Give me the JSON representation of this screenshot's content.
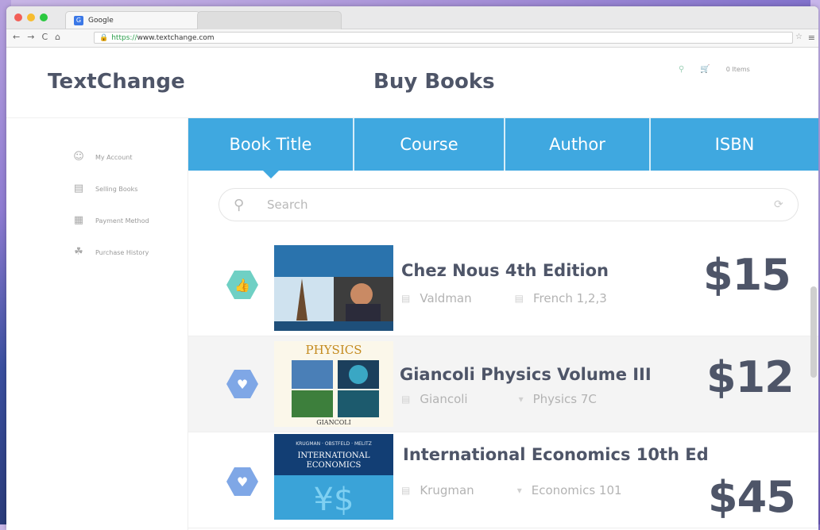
{
  "browser": {
    "tab_title": "Google",
    "tab_favicon": "google-favicon",
    "url_prefix": "https://",
    "url_rest": "www.textchange.com",
    "nav_back": "←",
    "nav_forward": "→",
    "nav_reload": "C",
    "nav_home": "⌂"
  },
  "app": {
    "logo": "TextChange",
    "page_title": "Buy Books",
    "top_right": {
      "user_icon": "user-icon",
      "cart_icon": "cart-icon",
      "cart_label": "0 Items"
    }
  },
  "sidebar": {
    "items": [
      {
        "label": "My Account",
        "icon": "user-icon"
      },
      {
        "label": "Selling Books",
        "icon": "book-icon"
      },
      {
        "label": "Payment Method",
        "icon": "wallet-icon"
      },
      {
        "label": "Purchase History",
        "icon": "history-icon"
      }
    ]
  },
  "search_tabs": [
    {
      "label": "Book Title",
      "active": true
    },
    {
      "label": "Course",
      "active": false
    },
    {
      "label": "Author",
      "active": false
    },
    {
      "label": "ISBN",
      "active": false
    }
  ],
  "search": {
    "placeholder": "Search"
  },
  "books": [
    {
      "title": "Chez Nous 4th Edition",
      "author": "Valdman",
      "course": "French 1,2,3",
      "price": "$15",
      "badge": "thumbs-up-icon",
      "badge_color": "#6fd0c4"
    },
    {
      "title": "Giancoli Physics Volume III",
      "author": "Giancoli",
      "course": "Physics 7C",
      "price": "$12",
      "badge": "heart-icon",
      "badge_color": "#7fa7e6"
    },
    {
      "title": "International Economics 10th Ed",
      "author": "Krugman",
      "course": "Economics 101",
      "price": "$45",
      "badge": "heart-icon",
      "badge_color": "#7fa7e6"
    }
  ],
  "colors": {
    "accent": "#3fa8e0",
    "text_dark": "#4e5568"
  }
}
